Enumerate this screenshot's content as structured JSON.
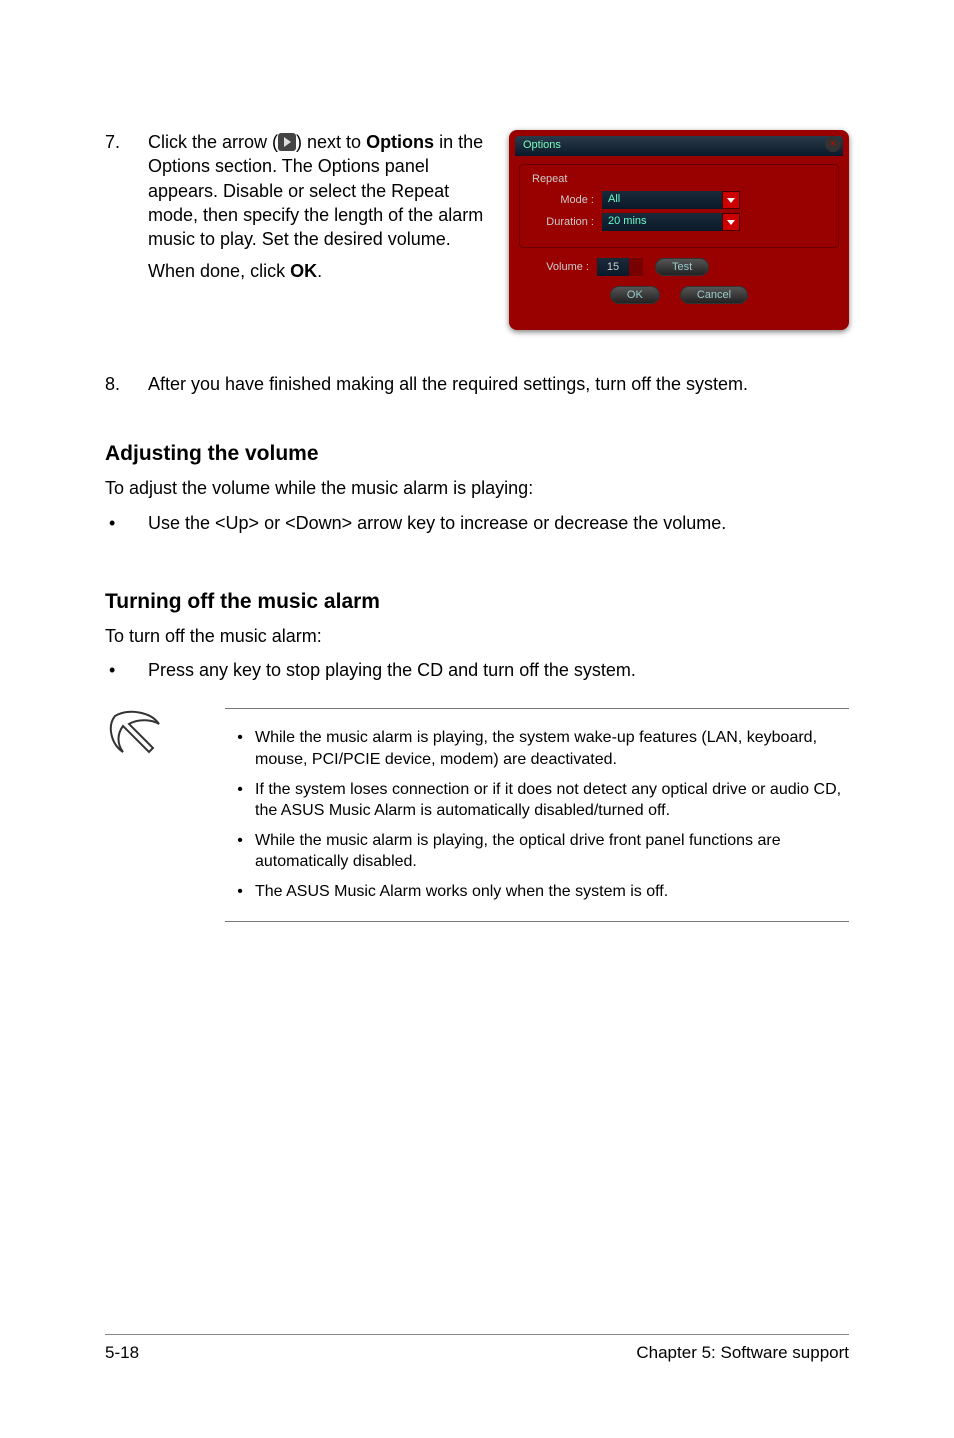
{
  "step7": {
    "num": "7.",
    "text_before_icon": "Click the arrow (",
    "text_after_icon": ") next to ",
    "options_bold": "Options",
    "text_rest": " in the Options section. The Options panel appears. Disable or select the Repeat mode, then specify the length of the alarm music to play. Set the desired volume.",
    "done_prefix": "When done, click ",
    "done_bold": "OK",
    "done_suffix": "."
  },
  "panel": {
    "title": "Options",
    "close": "×",
    "repeat": "Repeat",
    "mode_label": "Mode :",
    "mode_value": "All",
    "duration_label": "Duration :",
    "duration_value": "20 mins",
    "volume_label": "Volume :",
    "volume_value": "15",
    "test": "Test",
    "ok": "OK",
    "cancel": "Cancel"
  },
  "step8": {
    "num": "8.",
    "text": "After you have finished making all the required settings, turn off the system."
  },
  "adjusting": {
    "heading": "Adjusting the volume",
    "intro": "To adjust the volume while the music alarm is playing:",
    "bullet": "Use the  <Up> or <Down> arrow key to increase or decrease the volume."
  },
  "turning_off": {
    "heading": "Turning off the music alarm",
    "intro": "To turn off the music alarm:",
    "bullet": "Press any key to stop playing the CD and turn off the system."
  },
  "notes": [
    "While the music alarm is playing, the system wake-up features (LAN, keyboard, mouse, PCI/PCIE device, modem) are deactivated.",
    "If the system loses connection or if it does not detect any optical drive or audio CD, the ASUS Music Alarm is automatically disabled/turned off.",
    "While the music alarm is playing, the optical drive front panel functions are automatically disabled.",
    "The ASUS Music Alarm works only when the system is off."
  ],
  "footer": {
    "left": "5-18",
    "right": "Chapter 5: Software support"
  }
}
